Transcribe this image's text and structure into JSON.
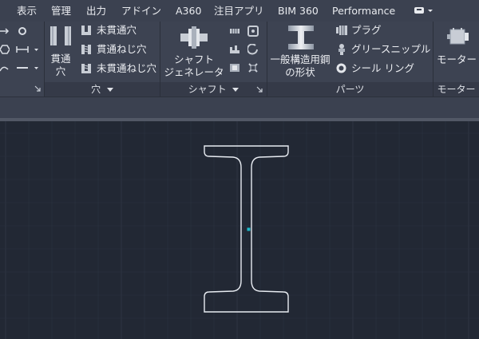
{
  "menu": {
    "tabs": [
      "表示",
      "管理",
      "出力",
      "アドイン",
      "A360",
      "注目アプリ",
      "BIM 360",
      "Performance"
    ]
  },
  "ribbon": {
    "hole_panel": {
      "title": "穴",
      "main_button": "貫通\n穴",
      "items": [
        "未貫通穴",
        "貫通ねじ穴",
        "未貫通ねじ穴"
      ]
    },
    "shaft_panel": {
      "title": "シャフト",
      "main_button": "シャフト\nジェネレータ"
    },
    "parts_panel": {
      "title": "パーツ",
      "main_button": "一般構造用鋼\nの形状",
      "items": [
        "プラグ",
        "グリースニップル",
        "シール リング"
      ]
    },
    "motor_panel": {
      "title": "モーター",
      "main_button": "モーター"
    }
  },
  "colors": {
    "canvas_bg": "#222834",
    "grid": "#2c3340",
    "shape_stroke": "#e8ecf2",
    "snap_marker": "#1fb8c9"
  }
}
